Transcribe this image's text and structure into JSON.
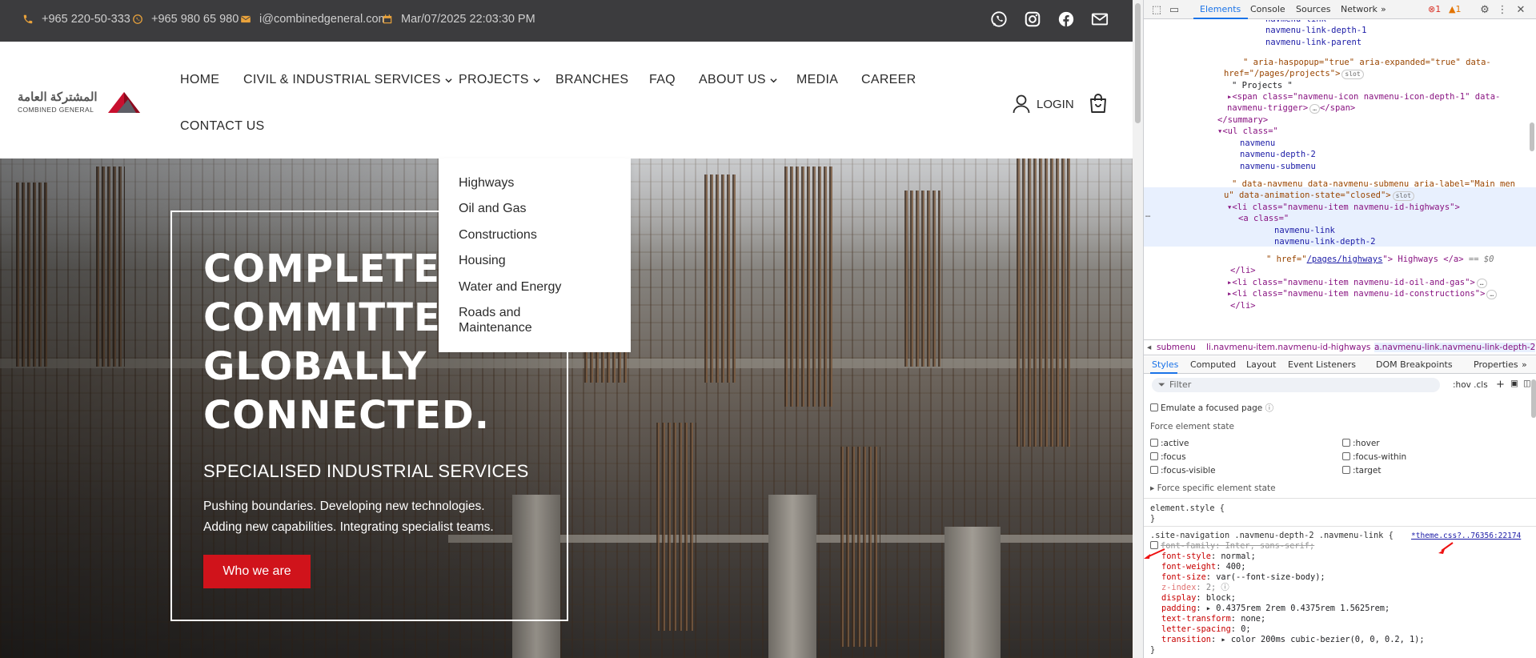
{
  "topbar": {
    "phone": "+965 220-50-333",
    "whatsapp": "+965 980 65 980",
    "email": "i@combinedgeneral.com",
    "datetime": "Mar/07/2025 22:03:30 PM",
    "icons": [
      "phone-icon",
      "whatsapp-icon",
      "email-icon",
      "calendar-icon"
    ],
    "social": [
      "whatsapp-icon",
      "instagram-icon",
      "facebook-icon",
      "mail-icon"
    ],
    "accent": "#e9a23b"
  },
  "logo": {
    "arabic": "المشتركة العامة",
    "english": "COMBINED GENERAL"
  },
  "nav": {
    "items": [
      "HOME",
      "CIVIL & INDUSTRIAL SERVICES",
      "PROJECTS",
      "BRANCHES",
      "FAQ",
      "ABOUT US",
      "MEDIA",
      "CAREER",
      "CONTACT US"
    ],
    "login": "LOGIN"
  },
  "dropdown": {
    "items": [
      "Highways",
      "Oil and Gas",
      "Constructions",
      "Housing",
      "Water and Energy",
      "Roads and Maintenance"
    ]
  },
  "hero": {
    "title_lines": [
      "COMPLETEL",
      "COMMITTED",
      "GLOBALLY",
      "CONNECTED."
    ],
    "subtitle": "SPECIALISED INDUSTRIAL SERVICES",
    "line1": "Pushing boundaries. Developing new technologies.",
    "line2": "Adding new capabilities. Integrating specialist teams.",
    "button": "Who we are",
    "button_color": "#d0131b"
  },
  "devtools": {
    "tabs": [
      "Elements",
      "Console",
      "Sources",
      "Network"
    ],
    "errors": "1",
    "warnings": "1",
    "dom": {
      "l1": "navmenu-link",
      "l2": "navmenu-link-depth-1",
      "l3": "navmenu-link-parent",
      "l4a": "\" aria-haspopup=\"true\" aria-expanded=\"true\" data-",
      "l4b": "href=\"/pages/projects\">",
      "l5": "\" Projects \"",
      "l6": "<span class=\"navmenu-icon navmenu-icon-depth-1\" data-",
      "l6b": "navmenu-trigger>",
      "l6c": "</span>",
      "l7": "</summary>",
      "l8": "<ul class=\"",
      "l9": "navmenu",
      "l10": "navmenu-depth-2",
      "l11": "navmenu-submenu",
      "l12": "\" data-navmenu data-navmenu-submenu aria-label=\"Main men",
      "l12b": "u\" data-animation-state=\"closed\">",
      "l13": "<li class=\"navmenu-item navmenu-id-highways\">",
      "l14": "<a class=\"",
      "l15": "navmenu-link",
      "l16": "navmenu-link-depth-2",
      "l17a": "\" href=\"",
      "l17b": "/pages/highways",
      "l17c": "\"> Highways </a>",
      "l17d": "== $0",
      "l18": "</li>",
      "l19": "<li class=\"navmenu-item navmenu-id-oil-and-gas\">",
      "l20": "<li class=\"navmenu-item navmenu-id-constructions\">",
      "l21": "</li>",
      "slot": "slot"
    },
    "breadcrumbs": [
      "submenu",
      "li.navmenu-item.navmenu-id-highways",
      "a.navmenu-link.navmenu-link-depth-2"
    ],
    "style_tabs": [
      "Styles",
      "Computed",
      "Layout",
      "Event Listeners",
      "DOM Breakpoints",
      "Properties"
    ],
    "filter_placeholder": "Filter",
    "filter_tools": ":hov .cls",
    "emulate": "Emulate a focused page",
    "force_state": "Force element state",
    "states_left": [
      ":active",
      ":focus",
      ":focus-visible"
    ],
    "states_right": [
      ":hover",
      ":focus-within",
      ":target"
    ],
    "force_specific": "Force specific element state",
    "element_style": "element.style {",
    "close_brace": "}",
    "rule_selector": ".site-navigation .navmenu-depth-2 .navmenu-link {",
    "rule_source": "*theme.css?..76356:22174",
    "decls": [
      {
        "name": "font-family",
        "value": "Inter, sans-serif;"
      },
      {
        "name": "font-style",
        "value": "normal;"
      },
      {
        "name": "font-weight",
        "value": "400;"
      },
      {
        "name": "font-size",
        "value": "var(--font-size-body);"
      },
      {
        "name": "z-index",
        "value": "2;"
      },
      {
        "name": "display",
        "value": "block;"
      },
      {
        "name": "padding",
        "value": "0.4375rem 2rem 0.4375rem 1.5625rem;"
      },
      {
        "name": "text-transform",
        "value": "none;"
      },
      {
        "name": "letter-spacing",
        "value": "0;"
      },
      {
        "name": "transition",
        "value": "color 200ms cubic-bezier(0, 0, 0.2, 1);"
      }
    ]
  }
}
